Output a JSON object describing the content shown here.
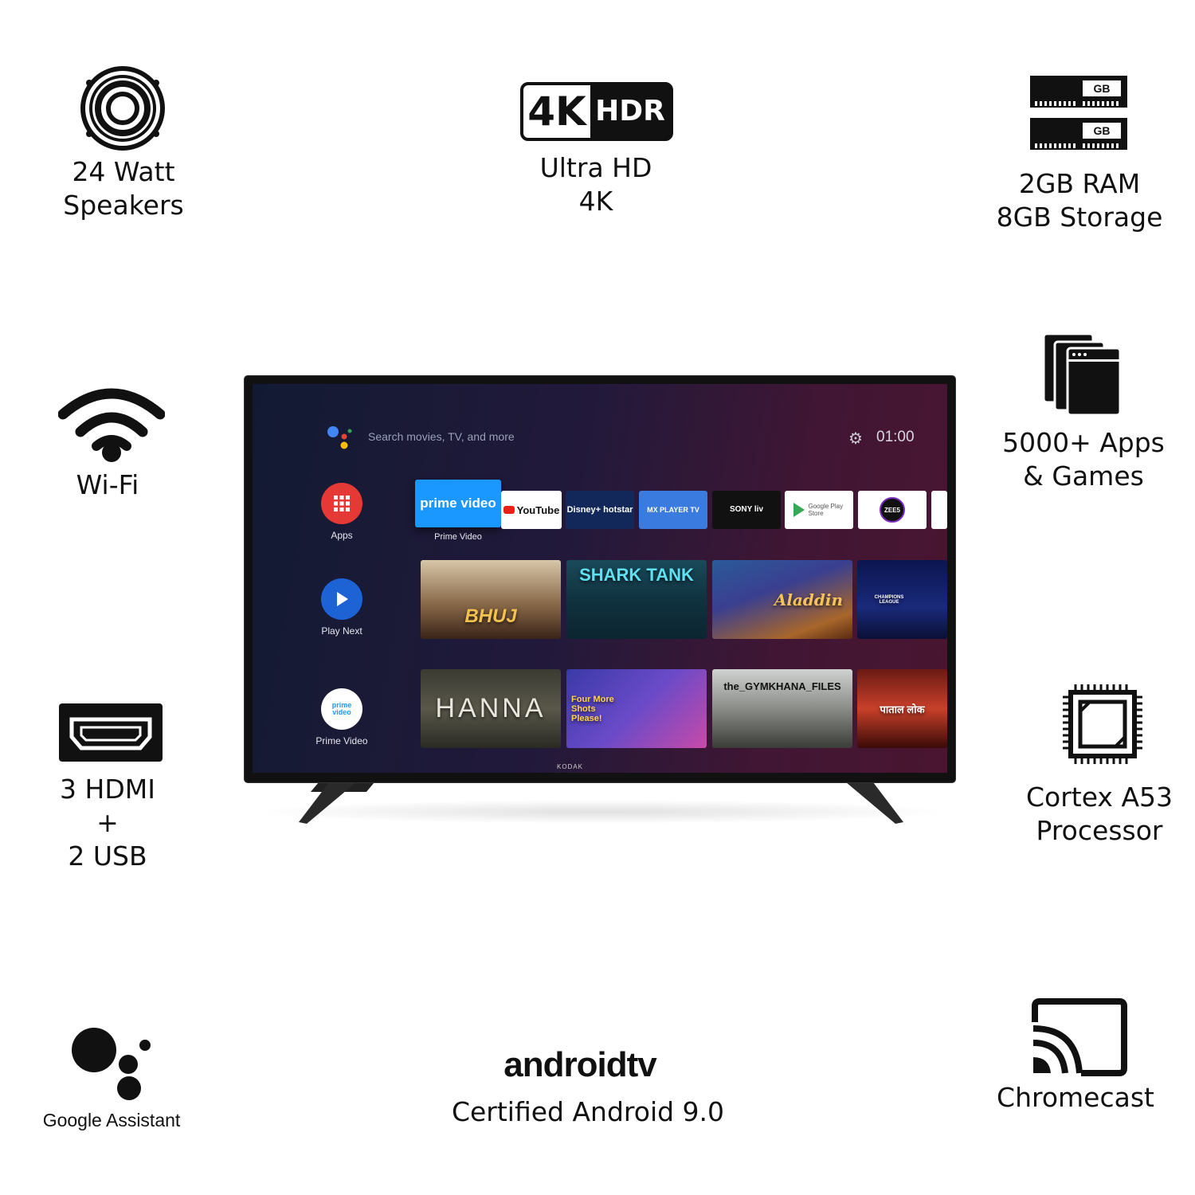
{
  "features": {
    "speakers": {
      "line1": "24 Watt",
      "line2": "Speakers"
    },
    "display": {
      "badge_4k": "4K",
      "badge_hdr": "HDR",
      "line1": "Ultra HD",
      "line2": "4K"
    },
    "memory": {
      "chip_label": "GB",
      "line1": "2GB RAM",
      "line2": "8GB Storage"
    },
    "wifi": {
      "line1": "Wi-Fi"
    },
    "apps": {
      "line1": "5000+ Apps",
      "line2": "& Games"
    },
    "ports": {
      "line1": "3 HDMI",
      "line2": "+",
      "line3": "2 USB"
    },
    "processor": {
      "line1": "Cortex A53",
      "line2": "Processor"
    },
    "assistant": {
      "line1": "Google Assistant"
    },
    "android": {
      "logo": "androidtv",
      "line1": "Certified Android 9.0"
    },
    "chromecast": {
      "line1": "Chromecast"
    }
  },
  "tv": {
    "brand": "KODAK",
    "search_placeholder": "Search movies, TV, and more",
    "clock": "01:00",
    "sidebar": [
      {
        "label": "Apps",
        "icon": "apps-grid-icon",
        "color": "#e53935"
      },
      {
        "label": "Play Next",
        "icon": "play-icon",
        "color": "#1e63d6"
      },
      {
        "label": "Prime Video",
        "icon": "prime-video-icon",
        "color": "#ffffff"
      }
    ],
    "app_row": {
      "focused_label": "Prime Video",
      "apps": [
        "prime video",
        "YouTube",
        "Disney+ hotstar",
        "MX PLAYER TV",
        "SONY liv",
        "Google Play Store",
        "ZEE5"
      ]
    },
    "row1": [
      "BHUJ",
      "SHARK TANK",
      "Aladdin",
      "CHAMPIONS LEAGUE"
    ],
    "row2": [
      "HANNA",
      "Four More Shots Please!",
      "the_GYMKHANA_FILES",
      "पाताल लोक"
    ]
  }
}
